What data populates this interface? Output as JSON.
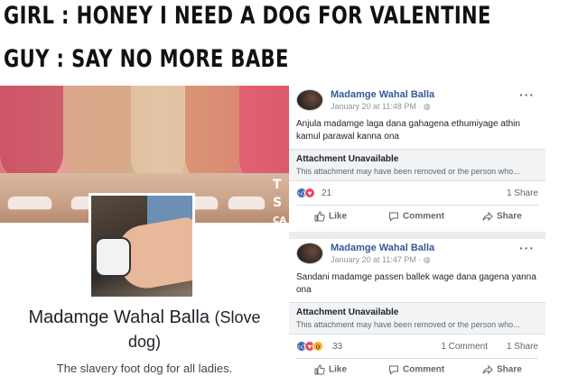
{
  "caption": {
    "line1": "Girl : Honey I need a dog for Valentine",
    "line2": "Guy : say no more babe"
  },
  "profile": {
    "cover_letters": [
      "T",
      "S",
      "CA"
    ],
    "name": "Madamge Wahal Balla",
    "name_suffix": "(Slove",
    "name_line2": "dog)",
    "description": "The slavery foot dog for all ladies."
  },
  "posts": [
    {
      "author": "Madamge Wahal Balla",
      "date": "January 20 at 11:48 PM · ",
      "menu": "···",
      "text": "Anjula madamge laga dana gahagena ethumiyage athin kamul parawal kanna ona",
      "attachment_title": "Attachment Unavailable",
      "attachment_desc": "This attachment may have been removed or the person who...",
      "reaction_count": "21",
      "comments": "",
      "shares": "1 Share",
      "reactions": [
        "like",
        "love"
      ],
      "actions": {
        "like": "Like",
        "comment": "Comment",
        "share": "Share"
      }
    },
    {
      "author": "Madamge Wahal Balla",
      "date": "January 20 at 11:47 PM · ",
      "menu": "···",
      "text": "Sandani madamge passen ballek wage dana gagena yanna ona",
      "attachment_title": "Attachment Unavailable",
      "attachment_desc": "This attachment may have been removed or the person who...",
      "reaction_count": "33",
      "comments": "1 Comment",
      "shares": "1 Share",
      "reactions": [
        "like",
        "love",
        "wow"
      ],
      "actions": {
        "like": "Like",
        "comment": "Comment",
        "share": "Share"
      }
    }
  ],
  "colors": {
    "facebook_blue": "#4267b2",
    "link_blue": "#365899",
    "love_red": "#e9475a",
    "wow_yellow": "#f7b125",
    "feed_bg": "#e9ebee"
  },
  "icons": {
    "post_menu": "ellipsis-icon",
    "globe": "globe-icon",
    "like": "thumbs-up-icon",
    "comment": "speech-bubble-icon",
    "share": "share-arrow-icon"
  }
}
